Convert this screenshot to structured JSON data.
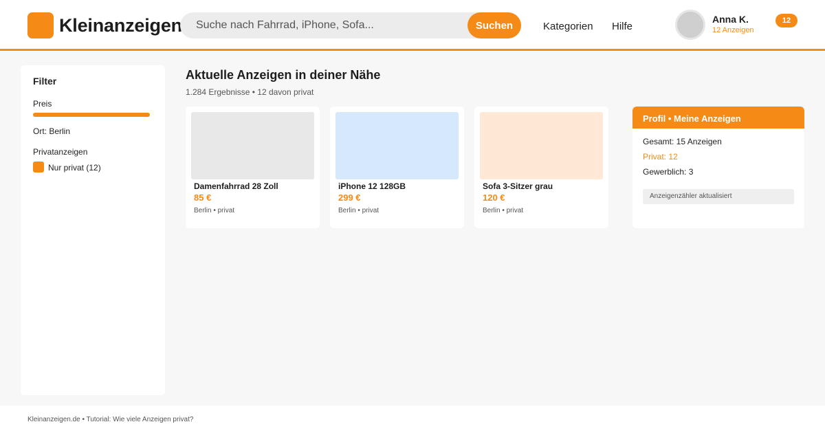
{
  "header": {
    "logo_text": "Kleinanzeigen",
    "search_placeholder": "Suche nach Fahrrad, iPhone, Sofa...",
    "search_button": "Suchen",
    "nav": [
      "Kategorien",
      "Hilfe"
    ],
    "user": {
      "name": "Anna K.",
      "ads_count": "12 Anzeigen"
    },
    "badge": "12"
  },
  "sidebar": {
    "title": "Filter",
    "price_label": "Preis",
    "location": "Ort: Berlin",
    "private_label": "Privatanzeigen",
    "checkbox_label": "Nur privat (12)",
    "checkbox_checked": true
  },
  "main": {
    "title": "Aktuelle Anzeigen in deiner Nähe",
    "subtitle": "1.284 Ergebnisse • 12 davon privat",
    "listings": [
      {
        "title": "Damenfahrrad 28 Zoll",
        "price": "85 €",
        "meta": "Berlin • privat",
        "image_color": "#e8e8e8"
      },
      {
        "title": "iPhone 12 128GB",
        "price": "299 €",
        "meta": "Berlin • privat",
        "image_color": "#d6e8fb"
      },
      {
        "title": "Sofa 3-Sitzer grau",
        "price": "120 €",
        "meta": "Berlin • privat",
        "image_color": "#ffe8d6"
      }
    ]
  },
  "profile": {
    "header": "Profil • Meine Anzeigen",
    "total": "Gesamt: 15 Anzeigen",
    "private": "Privat: 12",
    "commercial": "Gewerblich: 3",
    "status": "Anzeigenzähler aktualisiert"
  },
  "footer": {
    "text": "Kleinanzeigen.de • Tutorial: Wie viele Anzeigen privat?"
  },
  "colors": {
    "accent": "#f58b16",
    "background": "#f7f7f7"
  }
}
